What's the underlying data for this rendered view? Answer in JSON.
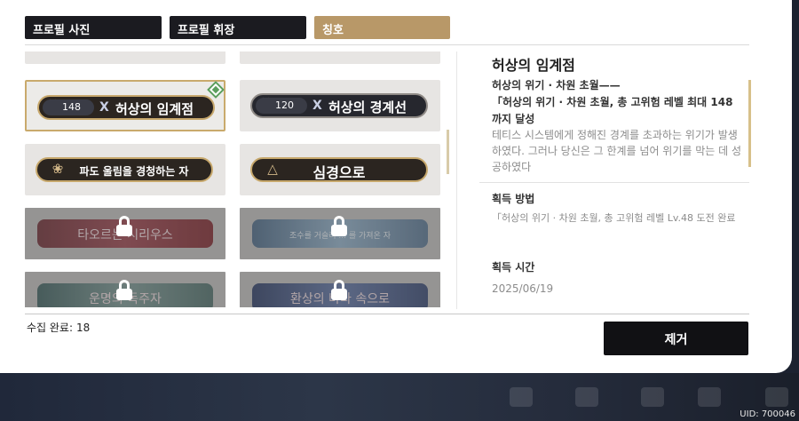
{
  "tabs": [
    {
      "label": "프로필 사진",
      "active": false
    },
    {
      "label": "프로필 휘장",
      "active": false
    },
    {
      "label": "칭호",
      "active": true
    }
  ],
  "titles": [
    {
      "level": "148",
      "symbol": "Ⅹ",
      "name": "허상의 임계점",
      "selected": true
    },
    {
      "level": "120",
      "symbol": "Ⅹ",
      "name": "허상의 경계선",
      "selected": false
    },
    {
      "name": "파도 울림을 경청하는 자",
      "emblem": "leaf-emblem-icon"
    },
    {
      "name": "심경으로",
      "emblem": "triangle-emblem-icon"
    },
    {
      "name": "타오르는 시리우스",
      "locked": true
    },
    {
      "name": "조수를 거슬러 ... 를 가져온 자",
      "locked": true
    },
    {
      "name": "운명의 독주자",
      "locked": true
    },
    {
      "name": "환상의 바다 속으로",
      "locked": true
    }
  ],
  "footer": {
    "collected_label": "수집 완료:",
    "collected_count": "18"
  },
  "detail": {
    "title": "허상의 임계점",
    "source_line1": "허상의 위기 · 차원 초월——",
    "source_line2": "「허상의 위기 · 차원 초월, 총 고위험 레벨 최대 148까지 달성",
    "description": "테티스 시스템에게 정해진 경계를 초과하는 위기가 발생하였다. 그러나 당신은 그 한계를 넘어 위기를 막는 데 성공하였다",
    "obtain_heading": "획득 방법",
    "obtain_value": "「허상의 위기 · 차원 초월, 총 고위험 레벨 Lv.48 도전 완료",
    "time_heading": "획득 시간",
    "time_value": "2025/06/19"
  },
  "remove_button": "제거",
  "uid": "UID: 700046"
}
